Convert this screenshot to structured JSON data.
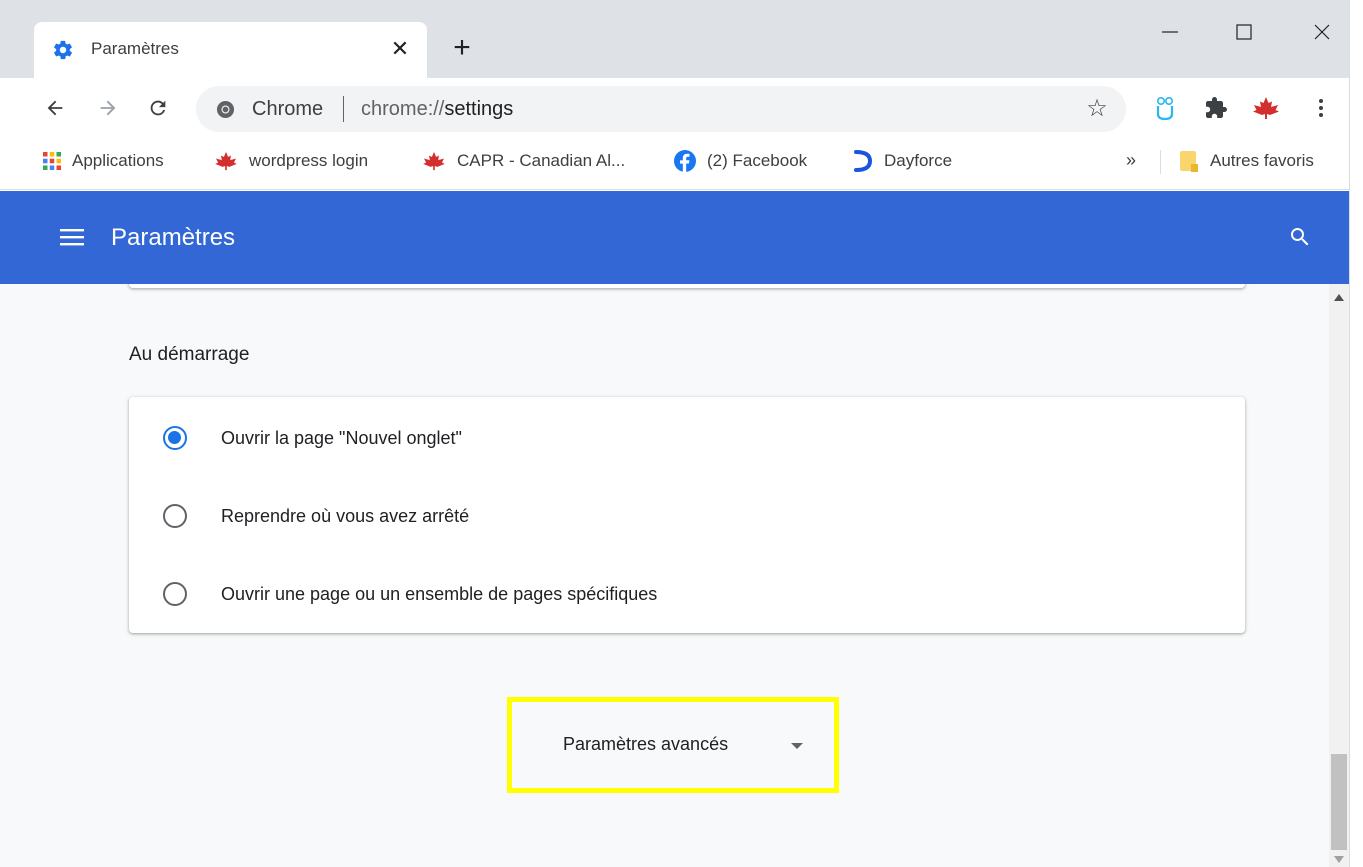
{
  "tab": {
    "title": "Paramètres",
    "close_glyph": "✕",
    "favicon": "gear-icon"
  },
  "new_tab_glyph": "+",
  "toolbar": {
    "site_label": "Chrome",
    "url_scheme": "chrome://",
    "url_host": "settings",
    "star_glyph": "☆"
  },
  "bookmarks": {
    "items": [
      {
        "label": "Applications",
        "icon": "apps-grid-icon"
      },
      {
        "label": "wordpress login",
        "icon": "maple-leaf-icon"
      },
      {
        "label": "CAPR - Canadian Al...",
        "icon": "maple-leaf-icon"
      },
      {
        "label": "(2) Facebook",
        "icon": "facebook-icon"
      },
      {
        "label": "Dayforce",
        "icon": "dayforce-icon"
      }
    ],
    "more_glyph": "»",
    "other_bookmarks": "Autres favoris"
  },
  "header": {
    "title": "Paramètres"
  },
  "startup": {
    "title": "Au démarrage",
    "options": [
      {
        "label": "Ouvrir la page \"Nouvel onglet\"",
        "checked": true
      },
      {
        "label": "Reprendre où vous avez arrêté",
        "checked": false
      },
      {
        "label": "Ouvrir une page ou un ensemble de pages spécifiques",
        "checked": false
      }
    ]
  },
  "advanced": {
    "label": "Paramètres avancés",
    "highlight_color": "#ffff00"
  },
  "colors": {
    "header_blue": "#3367d6",
    "radio_blue": "#1a73e8",
    "content_bg": "#f8f9fa"
  }
}
